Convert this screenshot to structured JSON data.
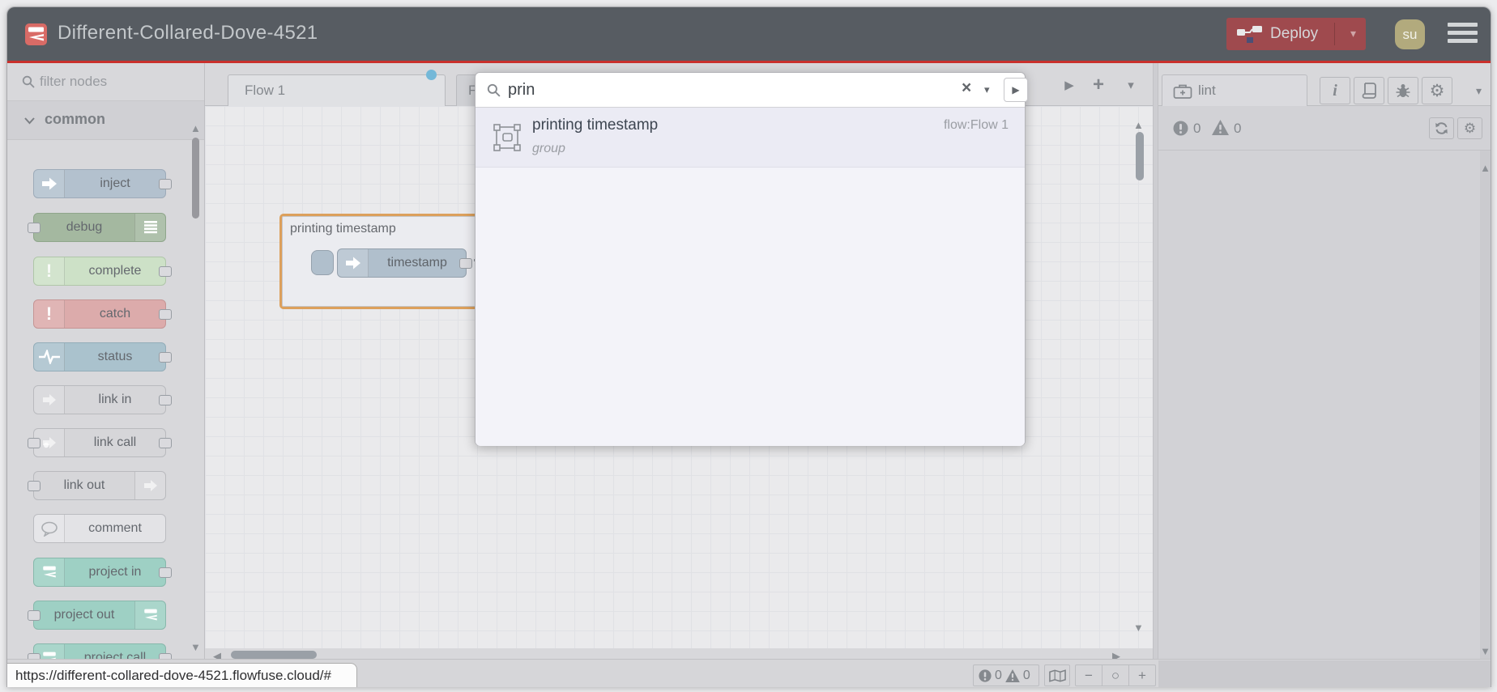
{
  "window": {
    "url_preview": "https://different-collared-dove-4521.flowfuse.cloud/#"
  },
  "header": {
    "title": "Different-Collared-Dove-4521",
    "deploy_label": "Deploy",
    "user_initials": "su"
  },
  "palette": {
    "filter_placeholder": "filter nodes",
    "category": "common",
    "nodes": [
      {
        "label": "inject"
      },
      {
        "label": "debug"
      },
      {
        "label": "complete"
      },
      {
        "label": "catch"
      },
      {
        "label": "status"
      },
      {
        "label": "link in"
      },
      {
        "label": "link call"
      },
      {
        "label": "link out"
      },
      {
        "label": "comment"
      },
      {
        "label": "project in"
      },
      {
        "label": "project out"
      },
      {
        "label": "project call"
      }
    ]
  },
  "workspace": {
    "tabs": [
      {
        "label": "Flow 1",
        "modified": true
      },
      {
        "label": "Fl"
      }
    ],
    "group": {
      "label": "printing timestamp",
      "node_label": "timestamp"
    },
    "footer": {
      "errors": "0",
      "warnings": "0"
    }
  },
  "search": {
    "query": "prin",
    "results": [
      {
        "title": "printing timestamp",
        "type": "group",
        "location": "flow:Flow 1"
      }
    ]
  },
  "sidebar": {
    "tab_label": "lint",
    "counts": {
      "errors": "0",
      "warnings": "0"
    }
  },
  "icons": {
    "chevron_down": "▾",
    "triangle_right": "▶",
    "triangle_left": "◀",
    "triangle_up": "▲",
    "triangle_down": "▼",
    "plus": "+",
    "clear": "×",
    "minus": "−",
    "circle": "○",
    "gear": "⚙",
    "exclamation": "!",
    "info": "i"
  },
  "colors": {
    "header_bg": "#575c62",
    "accent_red_line": "#c9302c",
    "deploy_bg": "#9f4a4e",
    "logo_bg": "#d96b66",
    "modified_dot": "#74b8d8",
    "group_selection": "#dca05c",
    "node_inject": "#b3c1ce",
    "node_debug": "#a4b8a0",
    "node_complete": "#cde1c7",
    "node_catch": "#dcabab",
    "node_status": "#aac2cd",
    "node_link": "#d6d6d9",
    "node_comment": "#e3e3e6",
    "node_project": "#9ed0c4",
    "search_row_bg": "#ebebf4"
  }
}
